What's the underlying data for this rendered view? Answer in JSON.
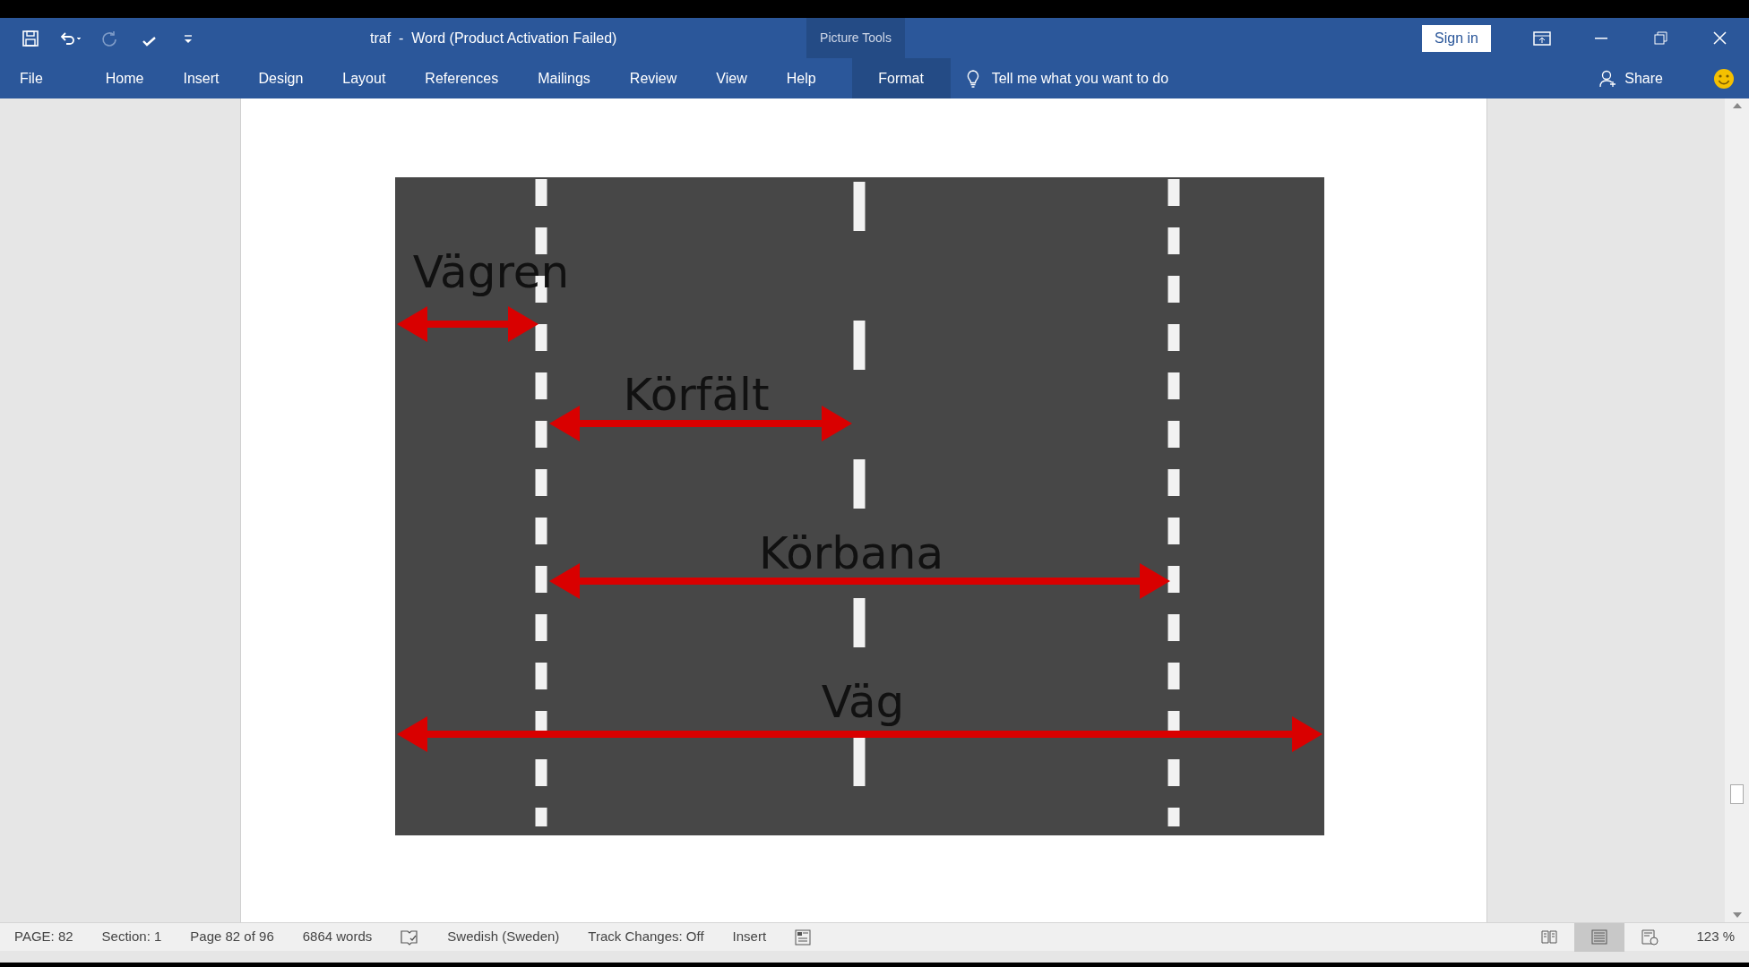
{
  "title_bar": {
    "quick_access": [
      {
        "kind": "save",
        "disabled": false
      },
      {
        "kind": "undo",
        "disabled": false
      },
      {
        "kind": "redo",
        "disabled": true
      },
      {
        "kind": "spelling",
        "disabled": false
      },
      {
        "kind": "customize",
        "disabled": false
      }
    ],
    "title": "traf  -  Word (Product Activation Failed)",
    "contextual_group": "Picture Tools",
    "sign_in": "Sign in"
  },
  "ribbon_tabs": [
    {
      "label": "File",
      "selected": false
    },
    {
      "label": "Home",
      "selected": false
    },
    {
      "label": "Insert",
      "selected": false
    },
    {
      "label": "Design",
      "selected": false
    },
    {
      "label": "Layout",
      "selected": false
    },
    {
      "label": "References",
      "selected": false
    },
    {
      "label": "Mailings",
      "selected": false
    },
    {
      "label": "Review",
      "selected": false
    },
    {
      "label": "View",
      "selected": false
    },
    {
      "label": "Help",
      "selected": false
    },
    {
      "label": "Format",
      "selected": true
    }
  ],
  "tell_me": {
    "placeholder": "Tell me what you want to do"
  },
  "share": "Share",
  "document": {
    "picture": {
      "labels": [
        "Vägren",
        "Körfält",
        "Körbana",
        "Väg"
      ]
    }
  },
  "status_bar": {
    "items": [
      "PAGE: 82",
      "Section: 1",
      "Page 82 of 96",
      "6864 words"
    ],
    "language": "Swedish (Sweden)",
    "track_changes": "Track Changes: Off",
    "mode": "Insert",
    "views": [
      {
        "kind": "read",
        "selected": false
      },
      {
        "kind": "print",
        "selected": true
      },
      {
        "kind": "web",
        "selected": false
      }
    ],
    "zoom": "123 %"
  }
}
